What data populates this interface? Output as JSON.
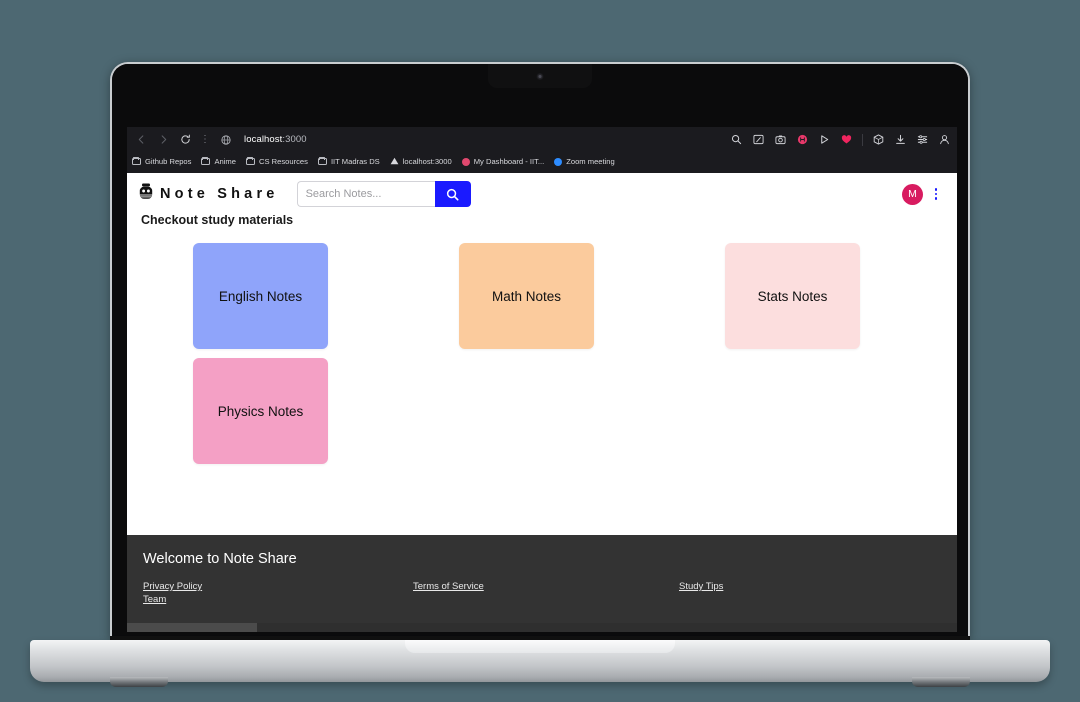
{
  "browser": {
    "nav": {
      "back_icon": "chevron-left-icon",
      "forward_icon": "chevron-right-icon",
      "reload_icon": "reload-icon",
      "more_icon": "vertical-dots-icon",
      "site_icon": "globe-icon",
      "url_host": "localhost",
      "url_port": ":3000"
    },
    "toolbar_icons": [
      "search-icon",
      "split-screen-icon",
      "screenshot-camera-icon",
      "record-circle-icon",
      "send-triangle-icon",
      "heart-icon",
      "extensions-box-icon",
      "downloads-icon",
      "reading-list-icon",
      "profile-icon"
    ],
    "bookmarks": [
      {
        "label": "Github Repos",
        "icon": "folder-icon",
        "color": ""
      },
      {
        "label": "Anime",
        "icon": "folder-icon",
        "color": ""
      },
      {
        "label": "CS Resources",
        "icon": "folder-icon",
        "color": ""
      },
      {
        "label": "IIT Madras DS",
        "icon": "folder-icon",
        "color": ""
      },
      {
        "label": "localhost:3000",
        "icon": "triangle-icon",
        "color": "#d8d8dd"
      },
      {
        "label": "My Dashboard - IIT...",
        "icon": "dot-icon",
        "color": "#e0486e"
      },
      {
        "label": "Zoom meeting",
        "icon": "dot-icon",
        "color": "#2d8cff"
      }
    ]
  },
  "app": {
    "brand": {
      "logo_icon": "robot-head-icon",
      "name": "Note Share"
    },
    "search": {
      "placeholder": "Search Notes...",
      "value": "",
      "button_icon": "search-icon",
      "button_color": "#1a1aff"
    },
    "user": {
      "avatar_initial": "M",
      "avatar_color": "#d81b60",
      "menu_icon": "vertical-dots-icon"
    },
    "section_title": "Checkout study materials",
    "notes": [
      {
        "label": "English Notes",
        "color": "#8fa4fa"
      },
      {
        "label": "Math Notes",
        "color": "#fbcb9d"
      },
      {
        "label": "Stats Notes",
        "color": "#fcdede"
      },
      {
        "label": "Physics Notes",
        "color": "#f4a0c5"
      }
    ],
    "footer": {
      "title": "Welcome to Note Share",
      "columns": [
        [
          "Privacy Policy",
          "Team"
        ],
        [
          "Terms of Service"
        ],
        [
          "Study Tips"
        ]
      ],
      "background": "#333333"
    }
  },
  "page": {
    "background": "#4d6872"
  }
}
